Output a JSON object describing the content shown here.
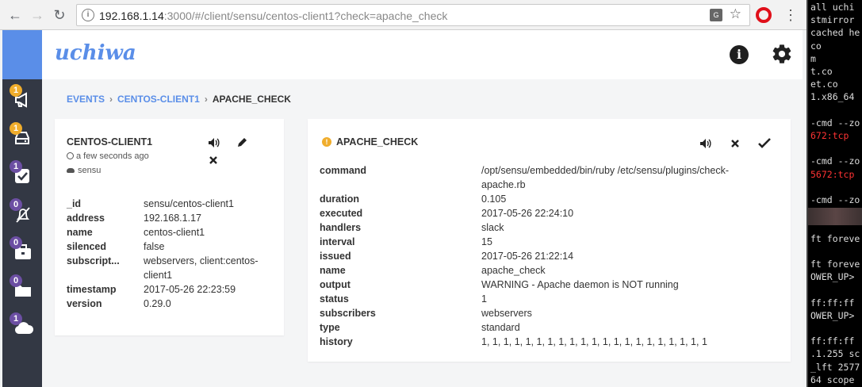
{
  "browser": {
    "url_host": "192.168.1.14",
    "url_rest": ":3000/#/client/sensu/centos-client1?check=apache_check",
    "translate_label": "G"
  },
  "app": {
    "logo": "uchiwa",
    "info_label": "i"
  },
  "sidebar": {
    "items": [
      {
        "icon": "megaphone-icon",
        "badge": "1",
        "badge_color": "#f0ad2c"
      },
      {
        "icon": "server-icon",
        "badge": "1",
        "badge_color": "#f0ad2c"
      },
      {
        "icon": "check-square-icon",
        "badge": "1",
        "badge_color": "#6c4fa3"
      },
      {
        "icon": "bell-slash-icon",
        "badge": "0",
        "badge_color": "#6c4fa3"
      },
      {
        "icon": "toolbox-icon",
        "badge": "0",
        "badge_color": "#6c4fa3"
      },
      {
        "icon": "folder-icon",
        "badge": "0",
        "badge_color": "#6c4fa3"
      },
      {
        "icon": "cloud-icon",
        "badge": "1",
        "badge_color": "#6c4fa3"
      }
    ]
  },
  "breadcrumb": {
    "events": "EVENTS",
    "client": "CENTOS-CLIENT1",
    "current": "APACHE_CHECK",
    "sep": "›"
  },
  "client": {
    "title": "CENTOS-CLIENT1",
    "last_seen": "a few seconds ago",
    "datacenter": "sensu",
    "fields": [
      {
        "key": "_id",
        "value": "sensu/centos-client1"
      },
      {
        "key": "address",
        "value": "192.168.1.17"
      },
      {
        "key": "name",
        "value": "centos-client1"
      },
      {
        "key": "silenced",
        "value": "false"
      },
      {
        "key": "subscript...",
        "value": "webservers, client:centos-client1"
      },
      {
        "key": "timestamp",
        "value": "2017-05-26 22:23:59"
      },
      {
        "key": "version",
        "value": "0.29.0"
      }
    ]
  },
  "check": {
    "title": "APACHE_CHECK",
    "status_color": "#f0ad2c",
    "fields": [
      {
        "key": "command",
        "value": "/opt/sensu/embedded/bin/ruby /etc/sensu/plugins/check-apache.rb"
      },
      {
        "key": "duration",
        "value": "0.105"
      },
      {
        "key": "executed",
        "value": "2017-05-26 22:24:10"
      },
      {
        "key": "handlers",
        "value": "slack"
      },
      {
        "key": "interval",
        "value": "15"
      },
      {
        "key": "issued",
        "value": "2017-05-26 21:22:14"
      },
      {
        "key": "name",
        "value": "apache_check"
      },
      {
        "key": "output",
        "value": "WARNING - Apache daemon is NOT running"
      },
      {
        "key": "status",
        "value": "1"
      },
      {
        "key": "subscribers",
        "value": "webservers"
      },
      {
        "key": "type",
        "value": "standard"
      },
      {
        "key": "history",
        "value": "1, 1, 1, 1, 1, 1, 1, 1, 1, 1, 1, 1, 1, 1, 1, 1, 1, 1, 1, 1, 1"
      }
    ]
  },
  "terminal": {
    "lines": [
      {
        "text": "all uchi",
        "red": false
      },
      {
        "text": "stmirror",
        "red": false
      },
      {
        "text": "cached he",
        "red": false
      },
      {
        "text": "co",
        "red": false
      },
      {
        "text": "m",
        "red": false
      },
      {
        "text": "t.co",
        "red": false
      },
      {
        "text": "et.co",
        "red": false
      },
      {
        "text": "1.x86_64",
        "red": false
      },
      {
        "text": "",
        "red": false
      },
      {
        "text": "-cmd --zo",
        "red": false
      },
      {
        "text": "672:tcp",
        "red": true
      },
      {
        "text": "",
        "red": false
      },
      {
        "text": "-cmd --zo",
        "red": false
      },
      {
        "text": "5672:tcp",
        "red": true
      },
      {
        "text": "",
        "red": false
      },
      {
        "text": "-cmd --zo",
        "red": false
      },
      {
        "text": "",
        "red": false
      },
      {
        "text": "",
        "red": false
      },
      {
        "text": "ft foreve",
        "red": false
      },
      {
        "text": "",
        "red": false
      },
      {
        "text": "ft foreve",
        "red": false
      },
      {
        "text": "OWER_UP>",
        "red": false
      },
      {
        "text": "",
        "red": false
      },
      {
        "text": " ff:ff:ff",
        "red": false
      },
      {
        "text": "OWER_UP>",
        "red": false
      },
      {
        "text": "",
        "red": false
      },
      {
        "text": " ff:ff:ff",
        "red": false
      },
      {
        "text": ".1.255 sc",
        "red": false
      },
      {
        "text": "_lft 2577",
        "red": false
      },
      {
        "text": "64 scope",
        "red": false
      }
    ]
  }
}
